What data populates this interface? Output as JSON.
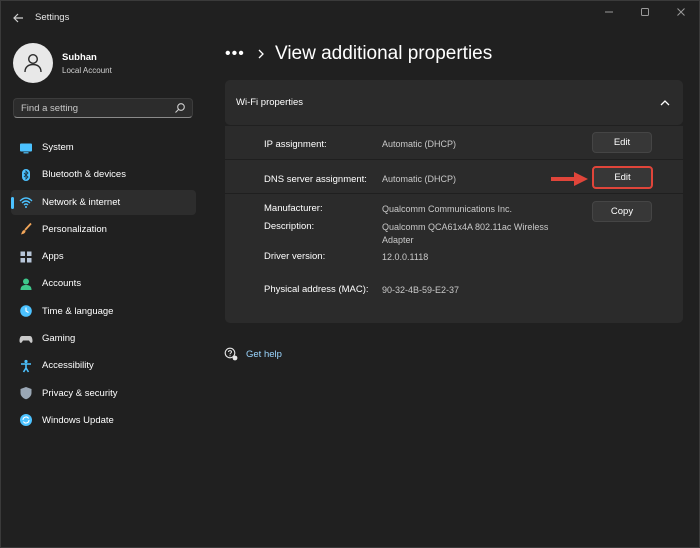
{
  "window": {
    "title": "Settings",
    "controls": [
      "minimize",
      "maximize",
      "close"
    ]
  },
  "profile": {
    "name": "Subhan",
    "account_type": "Local Account"
  },
  "search": {
    "placeholder": "Find a setting"
  },
  "sidebar": {
    "items": [
      {
        "label": "System",
        "icon": "system-icon",
        "color": "#4cc2ff",
        "active": false
      },
      {
        "label": "Bluetooth & devices",
        "icon": "bluetooth-icon",
        "color": "#4cc2ff",
        "active": false
      },
      {
        "label": "Network & internet",
        "icon": "wifi-icon",
        "color": "#4cc2ff",
        "active": true
      },
      {
        "label": "Personalization",
        "icon": "brush-icon",
        "color": "#f2a65a",
        "active": false
      },
      {
        "label": "Apps",
        "icon": "apps-icon",
        "color": "#b8c6d9",
        "active": false
      },
      {
        "label": "Accounts",
        "icon": "person-icon",
        "color": "#3ec98c",
        "active": false
      },
      {
        "label": "Time & language",
        "icon": "globe-clock-icon",
        "color": "#4cc2ff",
        "active": false
      },
      {
        "label": "Gaming",
        "icon": "controller-icon",
        "color": "#c9c9c9",
        "active": false
      },
      {
        "label": "Accessibility",
        "icon": "accessibility-icon",
        "color": "#4cc2ff",
        "active": false
      },
      {
        "label": "Privacy & security",
        "icon": "shield-icon",
        "color": "#9aa7b5",
        "active": false
      },
      {
        "label": "Windows Update",
        "icon": "update-icon",
        "color": "#4cc2ff",
        "active": false
      }
    ]
  },
  "breadcrumb": {
    "overflow": "•••",
    "title": "View additional properties"
  },
  "wifi_properties": {
    "header": "Wi-Fi properties",
    "ip_assignment": {
      "label": "IP assignment:",
      "value": "Automatic (DHCP)",
      "button": "Edit"
    },
    "dns_assignment": {
      "label": "DNS server assignment:",
      "value": "Automatic (DHCP)",
      "button": "Edit"
    },
    "manufacturer": {
      "label": "Manufacturer:",
      "value": "Qualcomm Communications Inc."
    },
    "description": {
      "label": "Description:",
      "value_line1": "Qualcomm QCA61x4A 802.11ac Wireless",
      "value_line2": "Adapter"
    },
    "driver_version": {
      "label": "Driver version:",
      "value": "12.0.0.1118"
    },
    "mac": {
      "label": "Physical address (MAC):",
      "value": "90-32-4B-59-E2-37"
    },
    "copy_button": "Copy"
  },
  "help": {
    "label": "Get help"
  },
  "colors": {
    "accent": "#4cc2ff",
    "highlight": "#e0453a"
  }
}
